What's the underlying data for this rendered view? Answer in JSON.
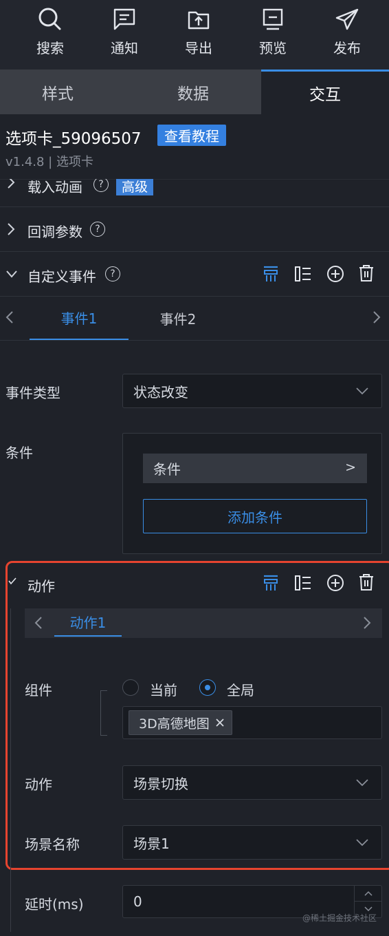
{
  "toolbar": [
    {
      "label": "搜索",
      "icon": "search-icon"
    },
    {
      "label": "通知",
      "icon": "message-icon"
    },
    {
      "label": "导出",
      "icon": "export-icon"
    },
    {
      "label": "预览",
      "icon": "preview-icon"
    },
    {
      "label": "发布",
      "icon": "send-icon"
    }
  ],
  "tabs": [
    {
      "label": "样式",
      "active": false
    },
    {
      "label": "数据",
      "active": false
    },
    {
      "label": "交互",
      "active": true
    }
  ],
  "component": {
    "title": "选项卡_59096507",
    "tutorial_label": "查看教程",
    "version": "v1.4.8 | 选项卡"
  },
  "sections": {
    "load_animation": {
      "label": "载入动画",
      "badge": "高级"
    },
    "callback_params": {
      "label": "回调参数"
    },
    "custom_events": {
      "label": "自定义事件"
    }
  },
  "events": {
    "tabs": [
      "事件1",
      "事件2"
    ],
    "active_tab": 0,
    "event_type_label": "事件类型",
    "event_type_value": "状态改变",
    "condition_label": "条件",
    "condition_item": "条件",
    "condition_item_arrow": ">",
    "add_condition_label": "添加条件"
  },
  "actions": {
    "section_label": "动作",
    "tabs": [
      "动作1"
    ],
    "component_label": "组件",
    "scope_options": [
      "当前",
      "全局"
    ],
    "scope_selected": "全局",
    "selected_component": "3D高德地图",
    "action_label": "动作",
    "action_value": "场景切换",
    "scene_name_label": "场景名称",
    "scene_name_value": "场景1",
    "delay_label": "延时(ms)",
    "delay_value": "0"
  },
  "watermark": "@稀土掘金技术社区",
  "colors": {
    "accent": "#3a8ee6",
    "highlight_border": "#e6442f",
    "background": "#1f2229"
  }
}
